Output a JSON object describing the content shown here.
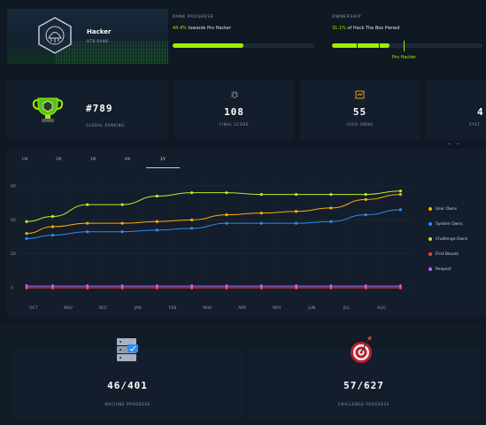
{
  "rank": {
    "name": "Hacker",
    "subtitle": "HTB RANK"
  },
  "rank_progress": {
    "label": "RANK PROGRESS",
    "percent": "44.4%",
    "text": " towards Pro Hacker",
    "fill": 0.444
  },
  "ownership": {
    "label": "OWNERSHIP",
    "percent": "31.1%",
    "text": " of Hack The Box Pwned",
    "fill": 0.311,
    "marker_label": "Pro Hacker"
  },
  "stats": [
    {
      "value": "#789",
      "label": "GLOBAL RANKING"
    },
    {
      "value": "108",
      "label": "FINAL SCORE"
    },
    {
      "value": "55",
      "label": "USER OWNS"
    },
    {
      "value": "4",
      "label": "SYST"
    }
  ],
  "time_tabs": [
    "1W",
    "1M",
    "3M",
    "6M",
    "1Y"
  ],
  "active_tab": "1Y",
  "colors": {
    "accent": "#9fef00",
    "user": "#ffaf00",
    "system": "#2e8cf0",
    "challenge": "#b5ee2c",
    "bloods": "#ff3e3e",
    "respect": "#b06ef0"
  },
  "chart_data": {
    "type": "line",
    "categories": [
      "OCT",
      "NOV",
      "DEC",
      "JAN",
      "FEB",
      "MAR",
      "APR",
      "MAY",
      "JUN",
      "JUL",
      "AUG"
    ],
    "x_points": [
      0,
      0.75,
      1.75,
      2.75,
      3.75,
      4.75,
      5.75,
      6.75,
      7.75,
      8.75,
      9.75,
      10.75
    ],
    "ylim": [
      0,
      60
    ],
    "yticks": [
      0,
      20,
      40,
      60
    ],
    "grid": true,
    "legend_position": "right",
    "series": [
      {
        "name": "User Owns",
        "color": "#ffaf00",
        "values": [
          32,
          36,
          38,
          38,
          39,
          40,
          43,
          44,
          45,
          47,
          52,
          55
        ]
      },
      {
        "name": "System Owns",
        "color": "#2e8cf0",
        "values": [
          29,
          31,
          33,
          33,
          34,
          35,
          38,
          38,
          38,
          39,
          43,
          46
        ]
      },
      {
        "name": "Challenge Owns",
        "color": "#b5ee2c",
        "values": [
          39,
          42,
          49,
          49,
          54,
          56,
          56,
          55,
          55,
          55,
          55,
          57
        ]
      },
      {
        "name": "First Bloods",
        "color": "#ff3e3e",
        "values": [
          0,
          0,
          0,
          0,
          0,
          0,
          0,
          0,
          0,
          0,
          0,
          0
        ]
      },
      {
        "name": "Respect",
        "color": "#b06ef0",
        "values": [
          1,
          1,
          1,
          1,
          1,
          1,
          1,
          1,
          1,
          1,
          1,
          1
        ]
      }
    ]
  },
  "machine_progress": {
    "value": "46/401",
    "label": "MACHINE PROGRESS"
  },
  "challenge_progress": {
    "value": "57/627",
    "label": "CHALLENGE PROGRESS"
  }
}
